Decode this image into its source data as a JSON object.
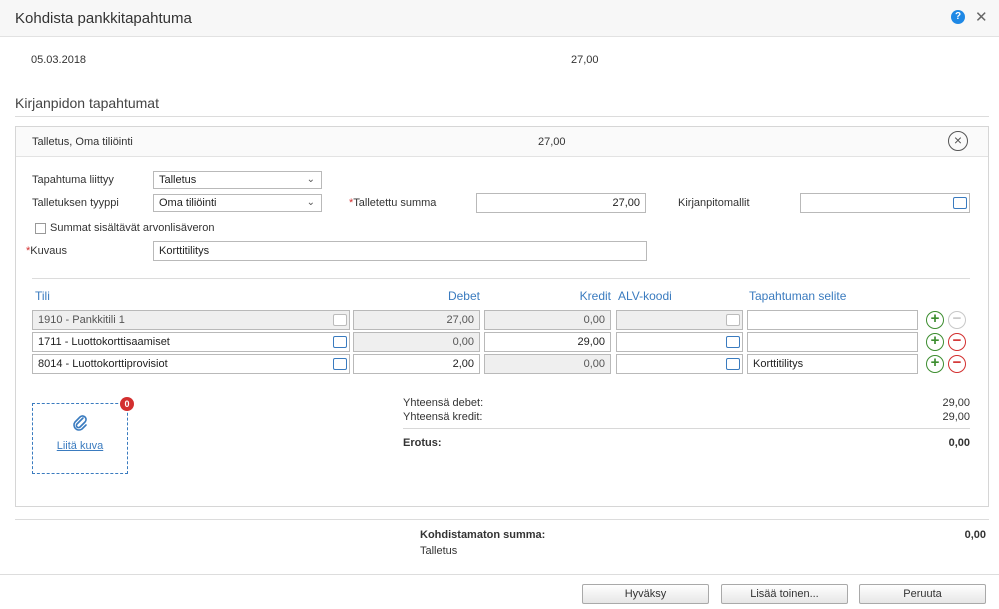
{
  "dialog": {
    "title": "Kohdista pankkitapahtuma"
  },
  "transaction": {
    "date": "05.03.2018",
    "amount": "27,00"
  },
  "section": {
    "title": "Kirjanpidon tapahtumat"
  },
  "entry": {
    "header_label": "Talletus, Oma tiliöinti",
    "header_amount": "27,00",
    "related_label": "Tapahtuma liittyy",
    "related_value": "Talletus",
    "deposit_type_label": "Talletuksen tyyppi",
    "deposit_type_value": "Oma tiliöinti",
    "deposited_sum_label": "Talletettu summa",
    "deposited_sum_value": "27,00",
    "templates_label": "Kirjanpitomallit",
    "templates_value": "",
    "vat_checkbox_label": "Summat sisältävät arvonlisäveron",
    "vat_checked": false,
    "description_label": "Kuvaus",
    "description_value": "Korttitilitys"
  },
  "table": {
    "headers": {
      "account": "Tili",
      "debit": "Debet",
      "credit": "Kredit",
      "vat_code": "ALV-koodi",
      "explanation": "Tapahtuman selite"
    },
    "rows": [
      {
        "account": "1910 - Pankkitili 1",
        "debit": "27,00",
        "credit": "0,00",
        "vat": "",
        "explanation": ""
      },
      {
        "account": "1711 - Luottokorttisaamiset",
        "debit": "0,00",
        "credit": "29,00",
        "vat": "",
        "explanation": ""
      },
      {
        "account": "8014 - Luottokorttiprovisiot",
        "debit": "2,00",
        "credit": "0,00",
        "vat": "",
        "explanation": "Korttitilitys"
      }
    ]
  },
  "attachment": {
    "label": "Liitä kuva",
    "count": "0"
  },
  "totals": {
    "debit_label": "Yhteensä debet:",
    "debit_value": "29,00",
    "credit_label": "Yhteensä kredit:",
    "credit_value": "29,00",
    "diff_label": "Erotus:",
    "diff_value": "0,00"
  },
  "unallocated": {
    "label": "Kohdistamaton summa:",
    "value": "0,00",
    "sub": "Talletus"
  },
  "buttons": {
    "accept": "Hyväksy",
    "add_another": "Lisää toinen...",
    "cancel": "Peruuta"
  },
  "icons": {
    "help": "question-icon",
    "close": "close-icon",
    "attach": "paperclip-icon",
    "lookup": "search-list-icon"
  },
  "colors": {
    "accent": "#3a7bbf",
    "required": "#d32f2f",
    "add": "#3c8d2f",
    "remove": "#d32f2f"
  }
}
